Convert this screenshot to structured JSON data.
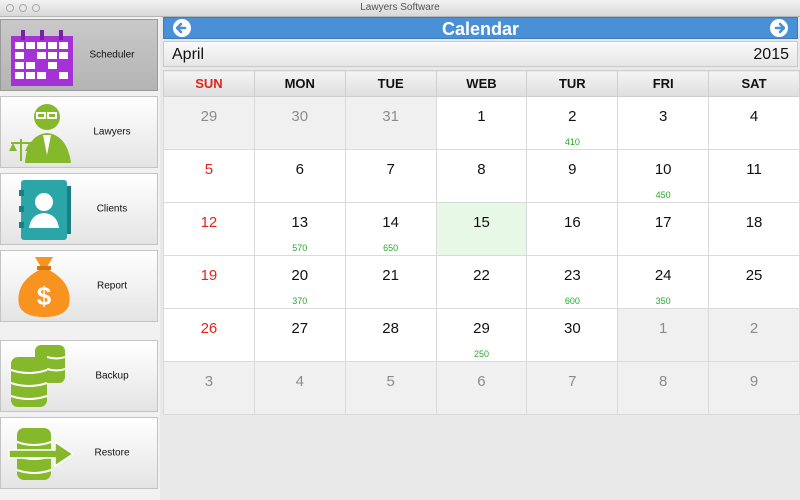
{
  "window": {
    "title": "Lawyers Software"
  },
  "sidebar": {
    "items": [
      {
        "label": "Scheduler",
        "icon": "calendar-icon",
        "active": true
      },
      {
        "label": "Lawyers",
        "icon": "lawyer-icon"
      },
      {
        "label": "Clients",
        "icon": "client-contact-icon"
      },
      {
        "label": "Report",
        "icon": "money-bag-icon"
      },
      {
        "label": "Backup",
        "icon": "database-icon"
      },
      {
        "label": "Restore",
        "icon": "database-restore-icon"
      }
    ]
  },
  "calendar": {
    "title": "Calendar",
    "month": "April",
    "year": "2015",
    "header_color": "#4a90d6",
    "weekdays": [
      "SUN",
      "MON",
      "TUE",
      "WEB",
      "TUR",
      "FRI",
      "SAT"
    ],
    "weeks": [
      [
        {
          "day": "29",
          "other": true
        },
        {
          "day": "30",
          "other": true
        },
        {
          "day": "31",
          "other": true
        },
        {
          "day": "1"
        },
        {
          "day": "2",
          "amount": "410"
        },
        {
          "day": "3"
        },
        {
          "day": "4"
        }
      ],
      [
        {
          "day": "5"
        },
        {
          "day": "6"
        },
        {
          "day": "7"
        },
        {
          "day": "8"
        },
        {
          "day": "9"
        },
        {
          "day": "10",
          "amount": "450"
        },
        {
          "day": "11"
        }
      ],
      [
        {
          "day": "12"
        },
        {
          "day": "13",
          "amount": "570"
        },
        {
          "day": "14",
          "amount": "650"
        },
        {
          "day": "15",
          "today": true
        },
        {
          "day": "16"
        },
        {
          "day": "17"
        },
        {
          "day": "18"
        }
      ],
      [
        {
          "day": "19"
        },
        {
          "day": "20",
          "amount": "370"
        },
        {
          "day": "21"
        },
        {
          "day": "22"
        },
        {
          "day": "23",
          "amount": "600"
        },
        {
          "day": "24",
          "amount": "350"
        },
        {
          "day": "25"
        }
      ],
      [
        {
          "day": "26"
        },
        {
          "day": "27"
        },
        {
          "day": "28"
        },
        {
          "day": "29",
          "amount": "250"
        },
        {
          "day": "30"
        },
        {
          "day": "1",
          "other": true
        },
        {
          "day": "2",
          "other": true
        }
      ],
      [
        {
          "day": "3",
          "other": true
        },
        {
          "day": "4",
          "other": true
        },
        {
          "day": "5",
          "other": true
        },
        {
          "day": "6",
          "other": true
        },
        {
          "day": "7",
          "other": true
        },
        {
          "day": "8",
          "other": true
        },
        {
          "day": "9",
          "other": true
        }
      ]
    ]
  }
}
